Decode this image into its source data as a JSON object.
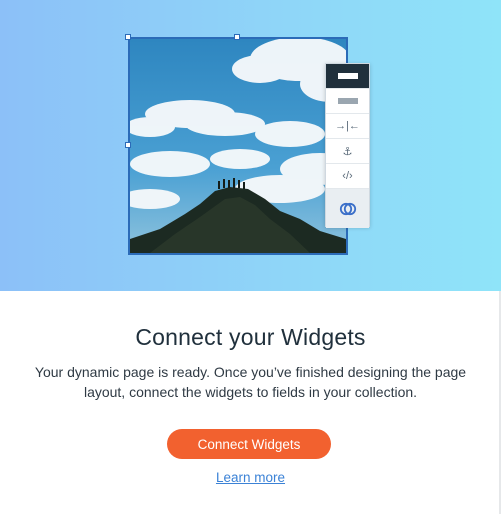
{
  "hero": {
    "illustration": "photo-of-sky-clouds-and-mountain-peak-with-people",
    "gradient_colors": [
      "#8cc0f8",
      "#8fe4f9"
    ],
    "selection_color": "#2b6bb8",
    "toolbar_icons": [
      "layout-full-icon",
      "layout-strip-icon",
      "stretch-icon",
      "anchor-icon",
      "code-icon",
      "connect-data-icon"
    ]
  },
  "content": {
    "title": "Connect your Widgets",
    "description": "Your dynamic page is ready. Once you’ve finished designing the page layout, connect the widgets to fields in your collection.",
    "cta_label": "Connect Widgets",
    "learn_more_label": "Learn more"
  },
  "colors": {
    "accent": "#f2612f",
    "link": "#3b82d6",
    "text": "#20303c"
  }
}
